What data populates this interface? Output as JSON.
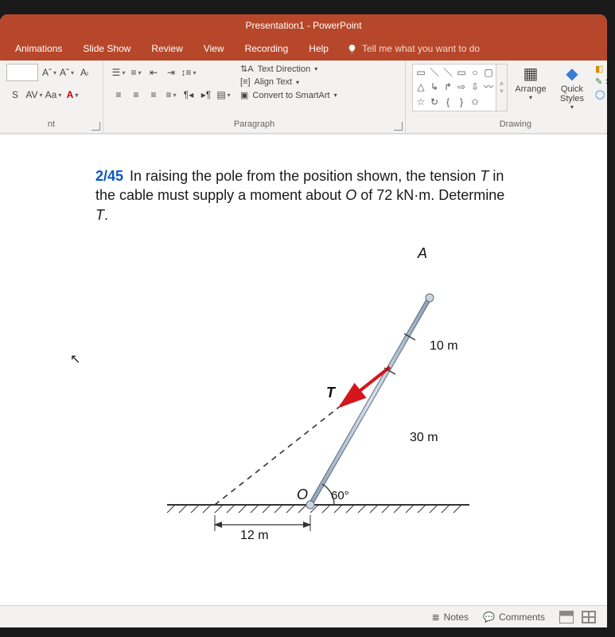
{
  "title": "Presentation1 - PowerPoint",
  "tabs": {
    "animations": "Animations",
    "slideshow": "Slide Show",
    "review": "Review",
    "view": "View",
    "recording": "Recording",
    "help": "Help"
  },
  "tellme": "Tell me what you want to do",
  "groups": {
    "font": "nt",
    "paragraph": "Paragraph",
    "drawing": "Drawing"
  },
  "font_tools": {
    "grow": "Aˆ",
    "shrink": "Aˇ",
    "clear": "Aₗ",
    "av": "AV",
    "aa": "Aa",
    "fontcolor": "A"
  },
  "para_tools": {
    "text_direction": "Text Direction",
    "align_text": "Align Text",
    "convert_smartart": "Convert to SmartArt"
  },
  "drawing_tools": {
    "arrange": "Arrange",
    "quick_styles": "Quick Styles",
    "shape_fill": "Sh",
    "shape_outline": "Sh",
    "shape_effects": "Sh"
  },
  "problem": {
    "number": "2/45",
    "text": "In raising the pole from the position shown, the tension T in the cable must supply a moment about O of 72 kN·m. Determine T.",
    "labels": {
      "A": "A",
      "T": "T",
      "O": "O",
      "angle": "60°",
      "len10": "10 m",
      "len30": "30 m",
      "len12": "12 m"
    }
  },
  "status": {
    "notes": "Notes",
    "comments": "Comments"
  }
}
